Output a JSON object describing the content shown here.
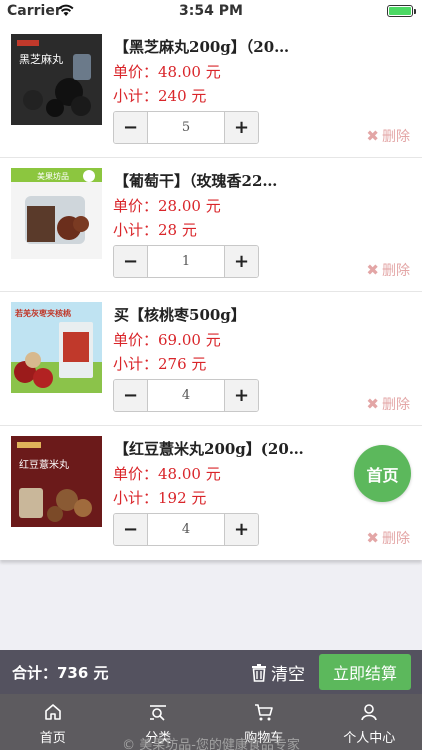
{
  "status_bar": {
    "carrier": "Carrier",
    "time": "3:54 PM"
  },
  "cart": {
    "unit_prefix": "单价：",
    "subtotal_prefix": "小计：",
    "delete_label": "删除",
    "items": [
      {
        "title": "【黑芝麻丸200g】（20…",
        "unit_price": "48.00 元",
        "subtotal": "240 元",
        "quantity": "5",
        "image_text": "黑芝麻丸"
      },
      {
        "title": "【葡萄干】（玫瑰香22…",
        "unit_price": "28.00 元",
        "subtotal": "28 元",
        "quantity": "1",
        "image_text": "美果坊品"
      },
      {
        "title": "买【核桃枣500g】",
        "unit_price": "69.00 元",
        "subtotal": "276 元",
        "quantity": "4",
        "image_text": "若羌灰枣夹核桃"
      },
      {
        "title": "【红豆薏米丸200g】(20…",
        "unit_price": "48.00 元",
        "subtotal": "192 元",
        "quantity": "4",
        "image_text": "红豆薏米丸"
      }
    ]
  },
  "float_home": {
    "label": "首页"
  },
  "total_bar": {
    "total": "合计：736 元",
    "clear": "清空",
    "checkout": "立即结算"
  },
  "watermark": "© 美果坊品-您的健康食品专家",
  "tabs": [
    {
      "label": "首页",
      "icon": "home-icon"
    },
    {
      "label": "分类",
      "icon": "category-search-icon"
    },
    {
      "label": "购物车",
      "icon": "cart-icon"
    },
    {
      "label": "个人中心",
      "icon": "user-icon"
    }
  ],
  "colors": {
    "price": "#d9252a",
    "accent_green": "#5cb85c",
    "bar_dark": "#54525f",
    "tab_bg": "#5d5b5f"
  }
}
